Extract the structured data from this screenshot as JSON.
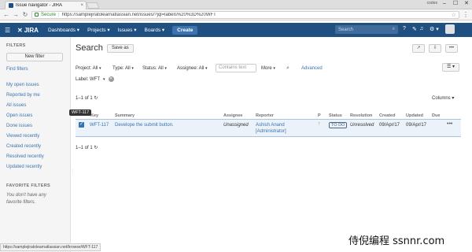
{
  "browser": {
    "tab_title": "Issue navigator - JIRA",
    "tab_close": "×",
    "user_badge": "codes",
    "window_controls": [
      "–",
      "☐",
      "✕"
    ],
    "secure_label": "Secure",
    "url": "https://samplejiratolearnatlassian.net/issues/?jql=labels%20%3D%20WFT",
    "status_url": "https://samplejiratolearnatlassian.net/browse/WFT-117"
  },
  "header": {
    "logo": "JIRA",
    "nav": [
      "Dashboards ▾",
      "Projects ▾",
      "Issues ▾",
      "Boards ▾"
    ],
    "create": "Create",
    "search_placeholder": "Search",
    "search_icon": "⌕",
    "icons": [
      "help-icon",
      "feedback-icon",
      "notification-icon",
      "settings-icon"
    ],
    "help_glyph": "?",
    "feedback_glyph": "✎",
    "notify_glyph": "♫",
    "gear_glyph": "⚙ ▾"
  },
  "sidebar": {
    "filters_heading": "FILTERS",
    "new_filter": "New filter",
    "find_filters": "Find filters",
    "items": [
      {
        "label": "My open issues"
      },
      {
        "label": "Reported by me"
      },
      {
        "label": "All issues"
      },
      {
        "label": "Open issues"
      },
      {
        "label": "Done issues"
      },
      {
        "label": "Viewed recently"
      },
      {
        "label": "Created recently"
      },
      {
        "label": "Resolved recently"
      },
      {
        "label": "Updated recently"
      }
    ],
    "favorite_heading": "FAVORITE FILTERS",
    "favorite_empty_1": "You don't have any",
    "favorite_empty_2": "favorite filters."
  },
  "main": {
    "title": "Search",
    "save_as": "Save as",
    "share_icon": "↗",
    "export_icon": "⇩",
    "more_icon": "•••",
    "filters": {
      "project": "Project: All",
      "type": "Type: All",
      "status": "Status: All",
      "assignee": "Assignee: All",
      "contains_placeholder": "Contains text",
      "more": "More",
      "advanced": "Advanced",
      "label": "Label: WFT"
    },
    "view_icon": "☰ ▾",
    "count_text": "1–1 of 1",
    "refresh_icon": "↻",
    "columns_btn": "Columns ▾",
    "tooltip": "WFT-117",
    "headers": {
      "key": "Key",
      "summary": "Summary",
      "assignee": "Assignee",
      "reporter": "Reporter",
      "p": "P",
      "status": "Status",
      "resolution": "Resolution",
      "created": "Created",
      "updated": "Updated",
      "due": "Due"
    },
    "rows": [
      {
        "key": "WFT-117",
        "summary": "Develope the submit button.",
        "assignee": "Unassigned",
        "reporter_name": "Ashish Anand",
        "reporter_role": "[Administrator]",
        "priority_icon": "↑",
        "status": "TO DO",
        "resolution": "Unresolved",
        "created": "09/Apr/17",
        "updated": "09/Apr/17",
        "due": "",
        "more": "•••"
      }
    ]
  },
  "watermark": "侍倪编程 ssnnr.com"
}
